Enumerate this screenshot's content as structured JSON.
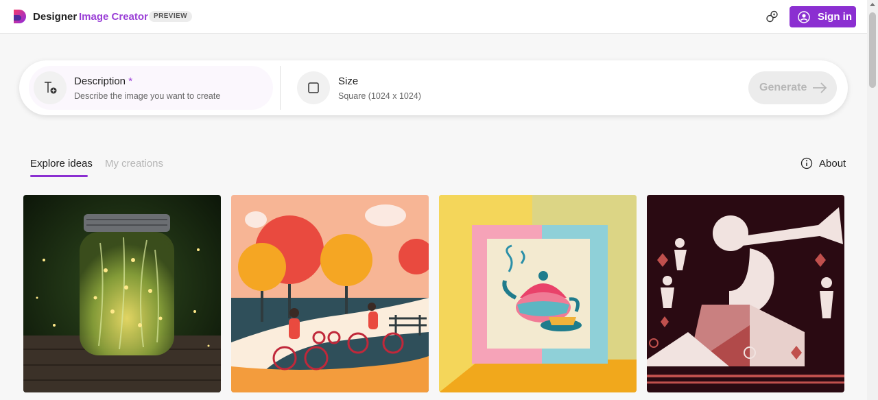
{
  "header": {
    "brand": "Designer",
    "product": "Image Creator",
    "badge": "PREVIEW",
    "rewards_icon": "rewards-icon",
    "signin_label": "Sign in"
  },
  "prompt": {
    "description_title": "Description",
    "description_required": "*",
    "description_hint": "Describe the image you want to create",
    "size_title": "Size",
    "size_value": "Square (1024 x 1024)",
    "generate_label": "Generate"
  },
  "tabs": [
    {
      "label": "Explore ideas",
      "active": true
    },
    {
      "label": "My creations",
      "active": false
    }
  ],
  "about_label": "About",
  "gallery": [
    {
      "name": "firefly-jar"
    },
    {
      "name": "autumn-park-cyclists"
    },
    {
      "name": "teapot-papercraft"
    },
    {
      "name": "geometric-trumpet-dancers"
    }
  ],
  "colors": {
    "accent": "#8b2fd1",
    "accent_text": "#9a3fd6"
  }
}
